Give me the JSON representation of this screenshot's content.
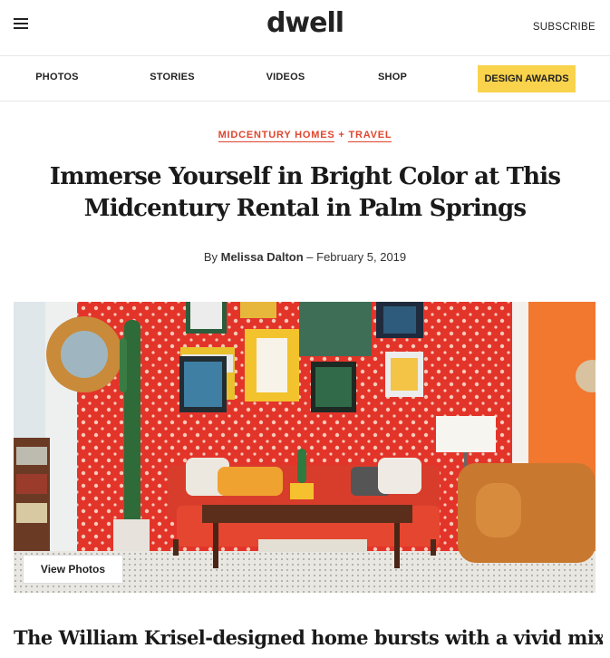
{
  "header": {
    "logo": "dwell",
    "subscribe_label": "SUBSCRIBE",
    "menu_icon": "hamburger-menu-icon"
  },
  "nav": {
    "items": [
      "PHOTOS",
      "STORIES",
      "VIDEOS",
      "SHOP"
    ],
    "highlight": "DESIGN AWARDS"
  },
  "article": {
    "categories": [
      "MIDCENTURY HOMES",
      "TRAVEL"
    ],
    "category_separator": "+",
    "title": "Immerse Yourself in Bright Color at This Midcentury Rental in Palm Springs",
    "byline_prefix": "By",
    "author": "Melissa Dalton",
    "byline_dash": "–",
    "date": "February 5, 2019",
    "view_photos_label": "View Photos",
    "dek": "The William Krisel-designed home bursts with a vivid mix of"
  },
  "colors": {
    "accent_red": "#e0452e",
    "awards_yellow": "#f9d34c",
    "text_dark": "#1a1a1a"
  }
}
